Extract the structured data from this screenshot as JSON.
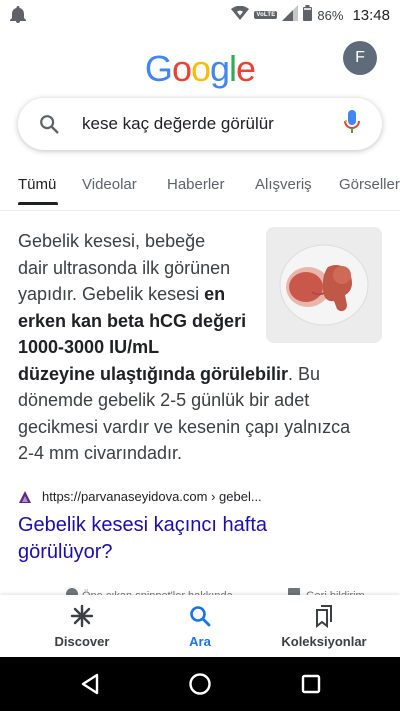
{
  "status_bar": {
    "battery": "86%",
    "time": "13:48",
    "volte": "VoLTE",
    "icons": [
      "notification-bell-icon",
      "wifi-icon",
      "signal-icon",
      "battery-icon"
    ]
  },
  "header": {
    "logo_letters": [
      "G",
      "o",
      "o",
      "g",
      "l",
      "e"
    ],
    "logo_colors": [
      "#4285F4",
      "#EA4335",
      "#FBBC05",
      "#4285F4",
      "#34A853",
      "#EA4335"
    ],
    "avatar_letter": "F"
  },
  "search": {
    "query": "kese kaç değerde görülür"
  },
  "tabs": [
    {
      "label": "Tümü",
      "active": true
    },
    {
      "label": "Videolar",
      "active": false
    },
    {
      "label": "Haberler",
      "active": false
    },
    {
      "label": "Alışveriş",
      "active": false
    },
    {
      "label": "Görseller",
      "active": false
    }
  ],
  "snippet": {
    "line1": "Gebelik kesesi, bebeğe",
    "line2": "dair ultrasonda ilk görünen",
    "line3a": "yapıdır. Gebelik kesesi ",
    "line3b": "en",
    "line4": "erken kan beta hCG değeri",
    "line5": "1000-3000 IU/mL",
    "line6a": "düzeyine ulaştığında görülebilir",
    "line6b": ". Bu",
    "line7": "dönemde gebelik 2-5 günlük bir adet",
    "line8": "gecikmesi vardır ve kesenin çapı yalnızca",
    "line9": "2-4 mm civarındadır."
  },
  "result": {
    "source_url": "https://parvanaseyidova.com › gebel...",
    "title_line1": "Gebelik kesesi kaçıncı hafta",
    "title_line2": "görülüyor?"
  },
  "about_row": {
    "left": "Öne çıkan snippet'ler hakkında",
    "right": "Geri bildirim"
  },
  "bottom_nav": [
    {
      "label": "Discover",
      "icon": "asterisk-icon",
      "active": false
    },
    {
      "label": "Ara",
      "icon": "search-icon",
      "active": true
    },
    {
      "label": "Koleksiyonlar",
      "icon": "collections-icon",
      "active": false
    }
  ],
  "colors": {
    "link": "#1a0dab",
    "accent": "#1a73e8",
    "text": "#202124"
  }
}
